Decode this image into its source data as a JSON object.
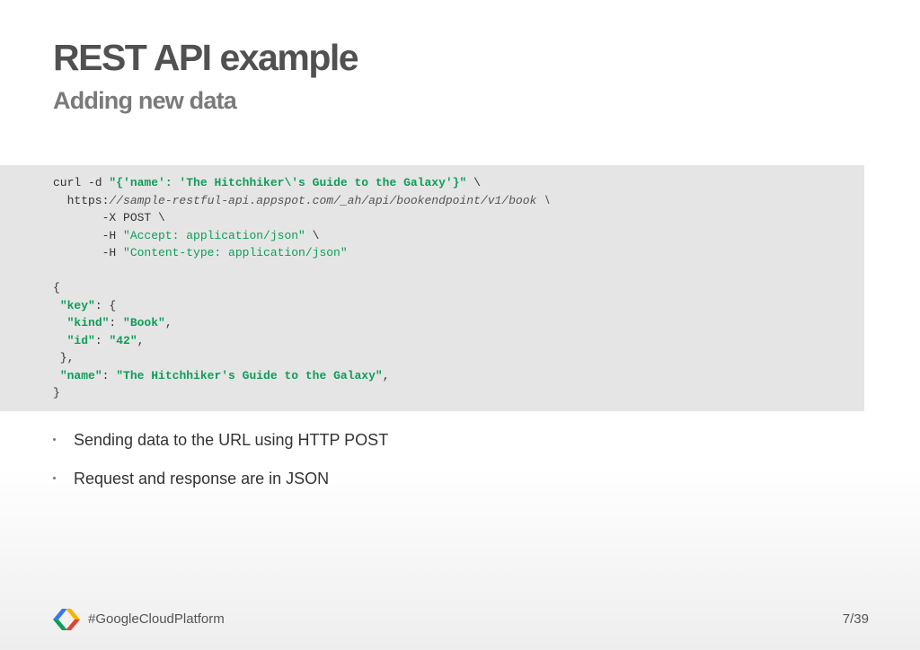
{
  "slide": {
    "title": "REST API example",
    "subtitle": "Adding new data"
  },
  "code": {
    "line1_a": "curl -d ",
    "line1_b": "\"{'name': 'The Hitchhiker\\'s Guide to the Galaxy'}\"",
    "line1_c": " \\",
    "line2_a": "  https:",
    "line2_b": "//sample-restful-api.appspot.com/_ah/api/bookendpoint/v1/book \\",
    "line3": "       -X POST \\",
    "line4_a": "       -H ",
    "line4_b": "\"Accept: application/json\"",
    "line4_c": " \\",
    "line5_a": "       -H ",
    "line5_b": "\"Content-type: application/json\"",
    "line7": "{",
    "line8_a": " ",
    "line8_b": "\"key\"",
    "line8_c": ": {",
    "line9_a": "  ",
    "line9_b": "\"kind\"",
    "line9_c": ": ",
    "line9_d": "\"Book\"",
    "line9_e": ",",
    "line10_a": "  ",
    "line10_b": "\"id\"",
    "line10_c": ": ",
    "line10_d": "\"42\"",
    "line10_e": ",",
    "line11": " },",
    "line12_a": " ",
    "line12_b": "\"name\"",
    "line12_c": ": ",
    "line12_d": "\"The Hitchhiker's Guide to the Galaxy\"",
    "line12_e": ",",
    "line13": "}"
  },
  "bullets": [
    "Sending data to the URL using HTTP POST",
    "Request and response are in JSON"
  ],
  "footer": {
    "hashtag": "#GoogleCloudPlatform",
    "page": "7/39",
    "logo_icon": "google-cloud-logo-icon"
  },
  "colors": {
    "title": "#515151",
    "subtitle": "#7a7a7a",
    "code_bg": "#e5e5e5",
    "string": "#0f9d58",
    "logo_blue": "#3b78e7",
    "logo_green": "#0f9d58",
    "logo_yellow": "#f4b400",
    "logo_red": "#db4437"
  }
}
